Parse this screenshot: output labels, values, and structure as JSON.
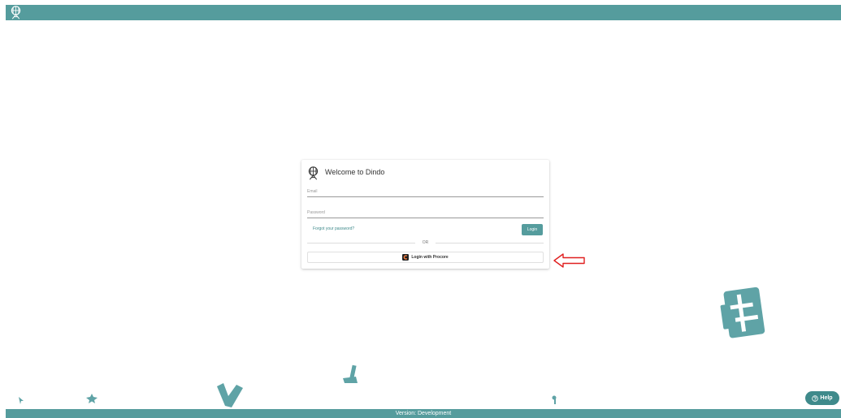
{
  "login": {
    "title": "Welcome to Dindo",
    "email_placeholder": "Email",
    "password_placeholder": "Password",
    "forgot_label": "Forgot your password?",
    "login_label": "Login",
    "or_label": "OR",
    "procore_label": "Login with Procore"
  },
  "help_label": "Help",
  "footer_text": "Version: Development",
  "colors": {
    "brand": "#559c9d",
    "accent": "#3f8a8b",
    "procore": "#f47e42",
    "annotation_arrow": "#e02020"
  },
  "icons": [
    "dindo-logo-icon",
    "procore-logo-icon",
    "help-circle-icon",
    "red-arrow-icon"
  ]
}
